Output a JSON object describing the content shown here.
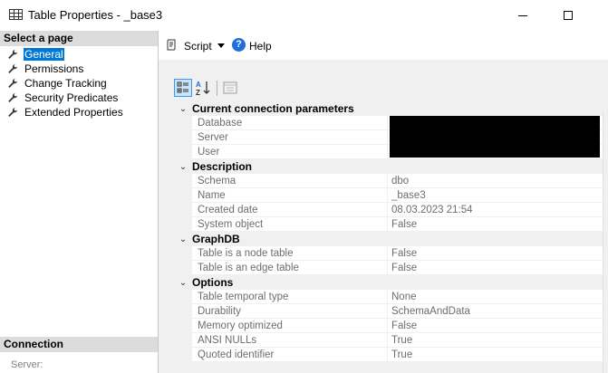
{
  "window": {
    "title": "Table Properties - _base3"
  },
  "sidebar": {
    "select_page_label": "Select a page",
    "pages": [
      {
        "label": "General",
        "selected": true
      },
      {
        "label": "Permissions",
        "selected": false
      },
      {
        "label": "Change Tracking",
        "selected": false
      },
      {
        "label": "Security Predicates",
        "selected": false
      },
      {
        "label": "Extended Properties",
        "selected": false
      }
    ],
    "connection_label": "Connection",
    "server_label": "Server:"
  },
  "toolbar": {
    "script_label": "Script",
    "help_label": "Help"
  },
  "grid": {
    "categories": [
      {
        "label": "Current connection parameters",
        "rows": [
          {
            "name": "Database",
            "value": ""
          },
          {
            "name": "Server",
            "value": ""
          },
          {
            "name": "User",
            "value": ""
          }
        ]
      },
      {
        "label": "Description",
        "rows": [
          {
            "name": "Schema",
            "value": "dbo"
          },
          {
            "name": "Name",
            "value": "_base3"
          },
          {
            "name": "Created date",
            "value": "08.03.2023 21:54"
          },
          {
            "name": "System object",
            "value": "False"
          }
        ]
      },
      {
        "label": "GraphDB",
        "rows": [
          {
            "name": "Table is a node table",
            "value": "False"
          },
          {
            "name": "Table is an edge table",
            "value": "False"
          }
        ]
      },
      {
        "label": "Options",
        "rows": [
          {
            "name": "Table temporal type",
            "value": "None"
          },
          {
            "name": "Durability",
            "value": "SchemaAndData"
          },
          {
            "name": "Memory optimized",
            "value": "False"
          },
          {
            "name": "ANSI NULLs",
            "value": "True"
          },
          {
            "name": "Quoted identifier",
            "value": "True"
          }
        ]
      }
    ]
  },
  "icons": {
    "title": "table-icon",
    "page": "wrench-icon",
    "script": "script-icon",
    "help": "help-icon",
    "categorized": "categorized-icon",
    "alphabetical": "sort-az-icon",
    "property_pages": "property-pages-icon"
  },
  "colors": {
    "selection": "#0078d7",
    "section_header": "#dcdcdc",
    "help": "#1e6fd9",
    "redaction": "#000000"
  }
}
